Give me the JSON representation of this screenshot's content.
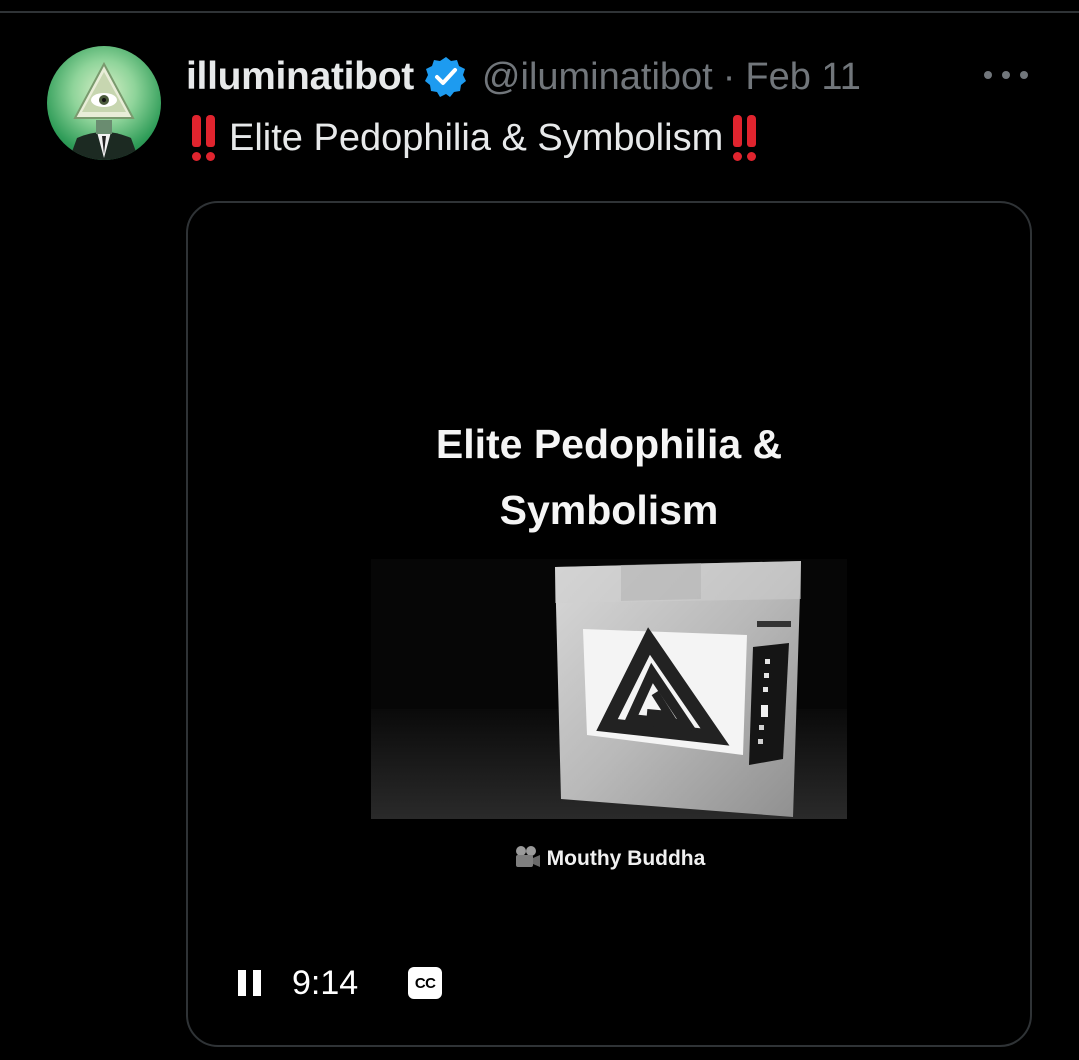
{
  "tweet": {
    "display_name": "illuminatibot",
    "handle": "@iluminatibot",
    "separator": "·",
    "date": "Feb 11",
    "text": "Elite Pedophilia & Symbolism",
    "verified_icon": "verified-badge-icon",
    "more_icon": "more-options-icon"
  },
  "video": {
    "title_line1": "Elite Pedophilia &",
    "title_line2": "Symbolism",
    "credit": "Mouthy Buddha",
    "time_remaining": "9:14",
    "cc_label": "CC",
    "pause_icon": "pause-icon",
    "camera_icon": "movie-camera-icon"
  },
  "colors": {
    "background": "#000000",
    "text": "#e7e9ea",
    "secondary": "#71767b",
    "verified": "#1d9bf0",
    "alert_red": "#e0242e"
  }
}
